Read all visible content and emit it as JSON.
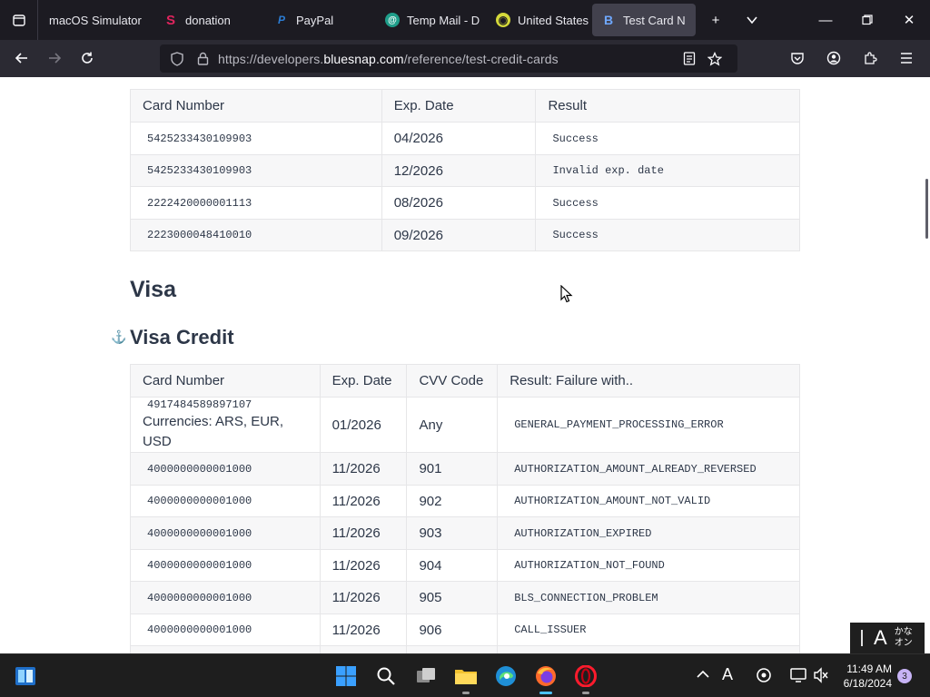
{
  "browser": {
    "tabs": [
      {
        "title": "macOS Simulator",
        "active": false
      },
      {
        "title": "donation",
        "active": false
      },
      {
        "title": "PayPal",
        "active": false
      },
      {
        "title": "Temp Mail - D",
        "active": false
      },
      {
        "title": "United States",
        "active": false
      },
      {
        "title": "Test Card N",
        "active": true
      }
    ],
    "url_prefix": "https://developers.",
    "url_domain": "bluesnap.com",
    "url_path": "/reference/test-credit-cards"
  },
  "mastercard_table": {
    "headers": [
      "Card Number",
      "Exp. Date",
      "Result"
    ],
    "rows": [
      [
        "5425233430109903",
        "04/2026",
        "Success"
      ],
      [
        "5425233430109903",
        "12/2026",
        "Invalid exp. date"
      ],
      [
        "2222420000001113",
        "08/2026",
        "Success"
      ],
      [
        "2223000048410010",
        "09/2026",
        "Success"
      ]
    ]
  },
  "headings": {
    "visa": "Visa",
    "visa_credit": "Visa Credit"
  },
  "visa_table": {
    "headers": [
      "Card Number",
      "Exp. Date",
      "CVV Code",
      "Result: Failure with.."
    ],
    "first_row": {
      "card": "4917484589897107",
      "note": "Currencies: ARS, EUR, USD",
      "exp": "01/2026",
      "cvv": "Any",
      "result": "GENERAL_PAYMENT_PROCESSING_ERROR"
    },
    "rows": [
      [
        "4000000000001000",
        "11/2026",
        "901",
        "AUTHORIZATION_AMOUNT_ALREADY_REVERSED"
      ],
      [
        "4000000000001000",
        "11/2026",
        "902",
        "AUTHORIZATION_AMOUNT_NOT_VALID"
      ],
      [
        "4000000000001000",
        "11/2026",
        "903",
        "AUTHORIZATION_EXPIRED"
      ],
      [
        "4000000000001000",
        "11/2026",
        "904",
        "AUTHORIZATION_NOT_FOUND"
      ],
      [
        "4000000000001000",
        "11/2026",
        "905",
        "BLS_CONNECTION_PROBLEM"
      ],
      [
        "4000000000001000",
        "11/2026",
        "906",
        "CALL_ISSUER"
      ]
    ]
  },
  "ime": {
    "letter": "A",
    "kana_top": "かな",
    "kana_bottom": "オン"
  },
  "taskbar": {
    "time": "11:49 AM",
    "date": "6/18/2024",
    "notifications": "3"
  },
  "colors": {
    "accent": "#4cc2ff",
    "tab_bg": "#1c1b22",
    "nav_bg": "#2b2a33"
  }
}
